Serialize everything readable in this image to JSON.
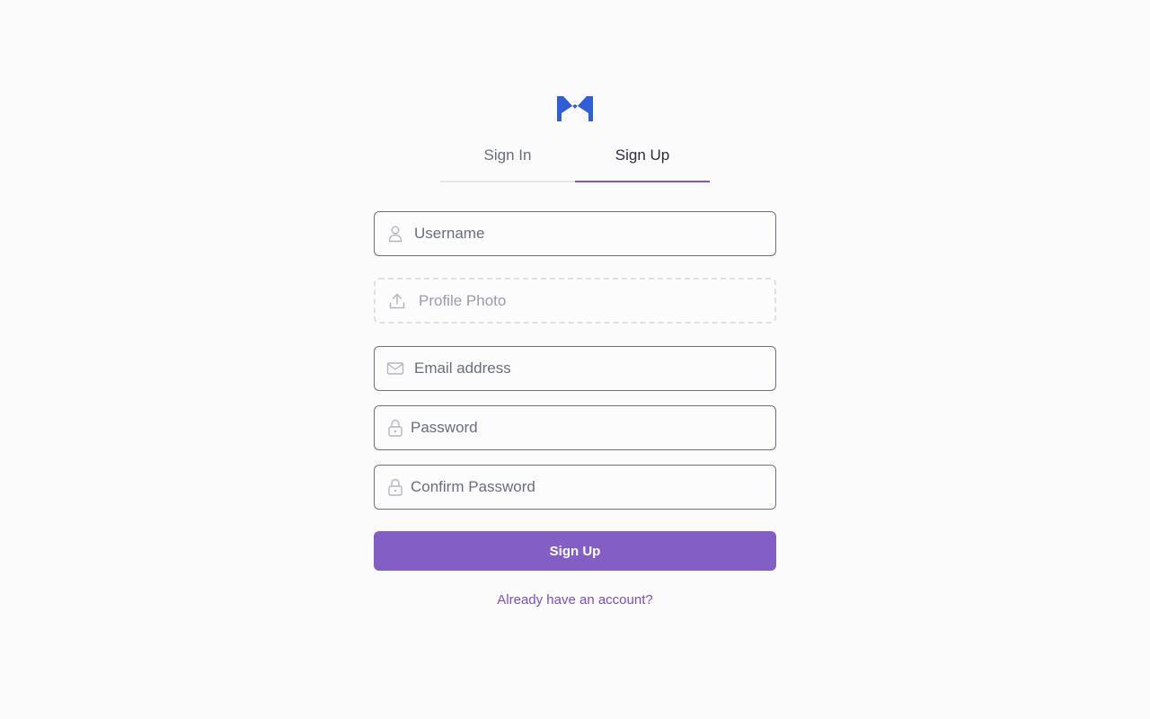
{
  "brand": {
    "logo_icon": "brand-m-logo",
    "logo_color": "#2f5fd6"
  },
  "tabs": [
    {
      "label": "Sign In",
      "active": false
    },
    {
      "label": "Sign Up",
      "active": true
    }
  ],
  "form": {
    "username": {
      "placeholder": "Username",
      "icon": "user-icon"
    },
    "profile_photo": {
      "label": "Profile Photo",
      "icon": "upload-icon"
    },
    "email": {
      "placeholder": "Email address",
      "icon": "mail-icon"
    },
    "password": {
      "placeholder": "Password",
      "icon": "lock-icon"
    },
    "confirm_password": {
      "placeholder": "Confirm Password",
      "icon": "lock-icon"
    },
    "submit_label": "Sign Up",
    "signin_link": "Already have an account?"
  },
  "colors": {
    "accent": "#835ec4",
    "link": "#7a4fbc",
    "tab_underline": "#7d58bf"
  }
}
